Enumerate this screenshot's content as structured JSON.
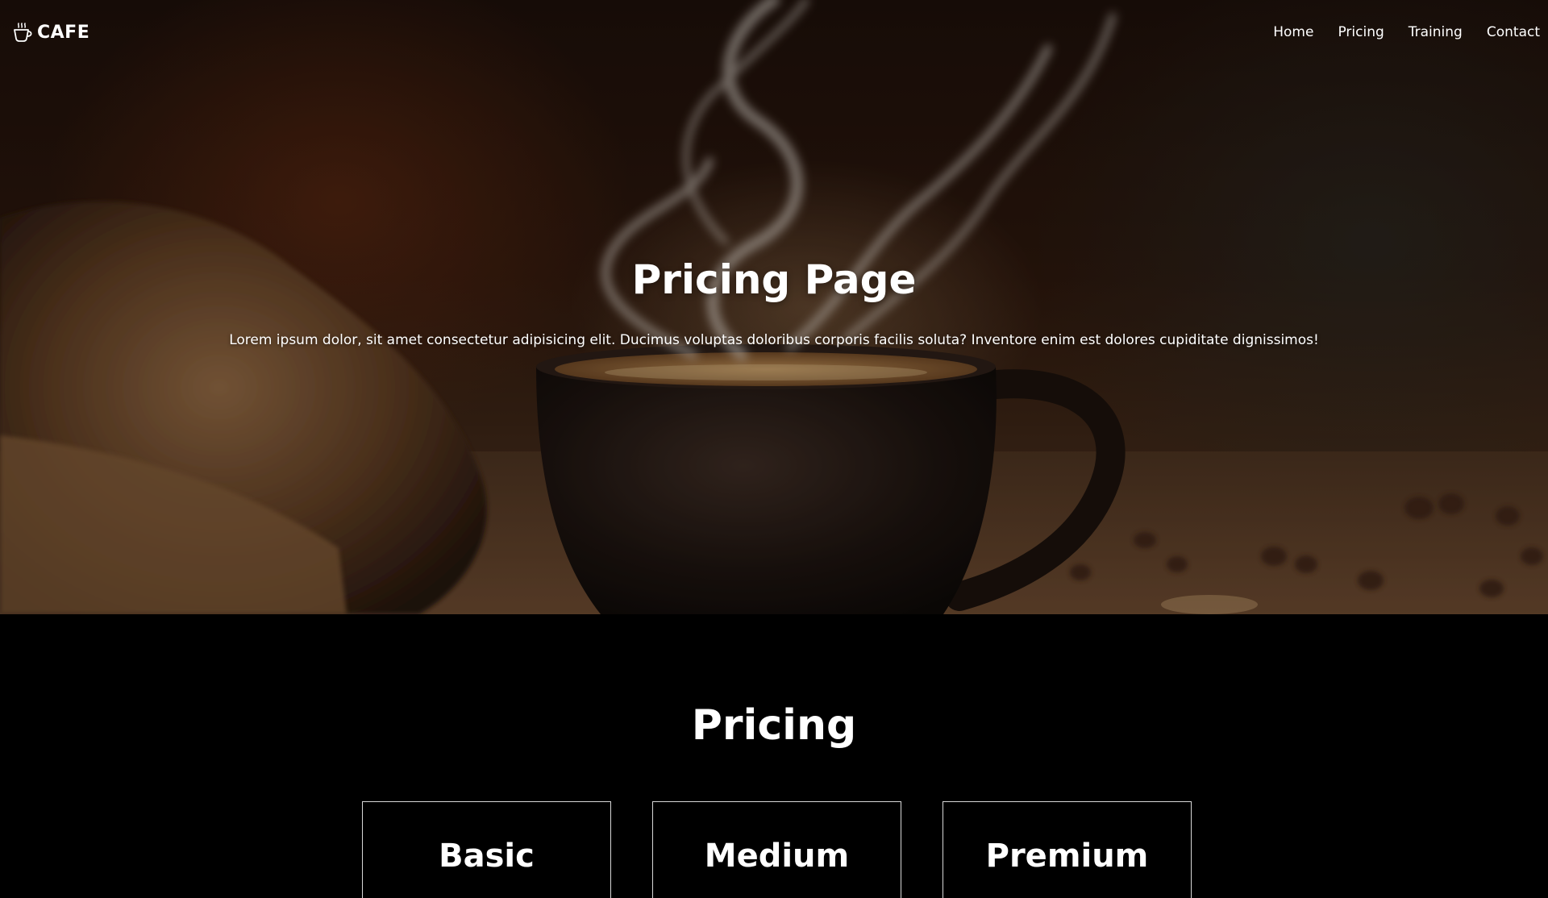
{
  "navbar": {
    "brand_icon": "coffee-cup-icon",
    "brand": "CAFE",
    "links": [
      "Home",
      "Pricing",
      "Training",
      "Contact"
    ]
  },
  "hero": {
    "title": "Pricing Page",
    "subtitle": "Lorem ipsum dolor, sit amet consectetur adipisicing elit. Ducimus voluptas doloribus corporis facilis soluta? Inventore enim est dolores cupiditate dignissimos!"
  },
  "pricing": {
    "title": "Pricing",
    "plans": [
      "Basic",
      "Medium",
      "Premium"
    ]
  }
}
